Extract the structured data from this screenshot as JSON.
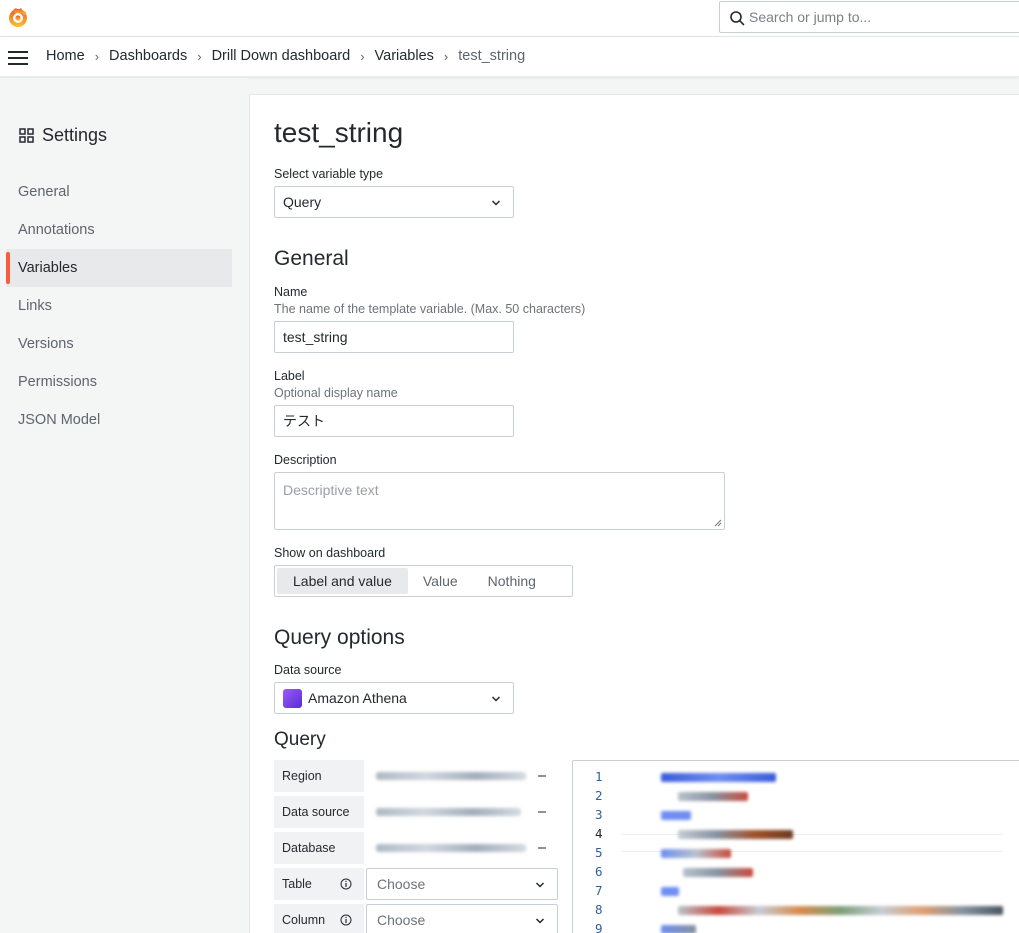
{
  "search": {
    "placeholder": "Search or jump to..."
  },
  "breadcrumb": [
    "Home",
    "Dashboards",
    "Drill Down dashboard",
    "Variables",
    "test_string"
  ],
  "sidebar": {
    "title": "Settings",
    "items": [
      {
        "label": "General",
        "active": false
      },
      {
        "label": "Annotations",
        "active": false
      },
      {
        "label": "Variables",
        "active": true
      },
      {
        "label": "Links",
        "active": false
      },
      {
        "label": "Versions",
        "active": false
      },
      {
        "label": "Permissions",
        "active": false
      },
      {
        "label": "JSON Model",
        "active": false
      }
    ]
  },
  "page": {
    "title": "test_string"
  },
  "variable_type": {
    "label": "Select variable type",
    "value": "Query"
  },
  "general": {
    "heading": "General",
    "name": {
      "label": "Name",
      "description": "The name of the template variable. (Max. 50 characters)",
      "value": "test_string"
    },
    "display_label": {
      "label": "Label",
      "description": "Optional display name",
      "value": "テスト"
    },
    "description": {
      "label": "Description",
      "placeholder": "Descriptive text"
    },
    "show_on_dashboard": {
      "label": "Show on dashboard",
      "options": [
        "Label and value",
        "Value",
        "Nothing"
      ],
      "selected": "Label and value"
    }
  },
  "query_options": {
    "heading": "Query options",
    "data_source": {
      "label": "Data source",
      "value": "Amazon Athena"
    },
    "query_heading": "Query",
    "fields": [
      {
        "label": "Region"
      },
      {
        "label": "Data source"
      },
      {
        "label": "Database"
      },
      {
        "label": "Table",
        "placeholder": "Choose"
      },
      {
        "label": "Column",
        "placeholder": "Choose"
      }
    ],
    "editor_line_numbers": [
      "1",
      "2",
      "3",
      "4",
      "5",
      "6",
      "7",
      "8",
      "9"
    ]
  },
  "colors": {
    "accent": "#f55f3e",
    "link": "#2f5f9a"
  }
}
